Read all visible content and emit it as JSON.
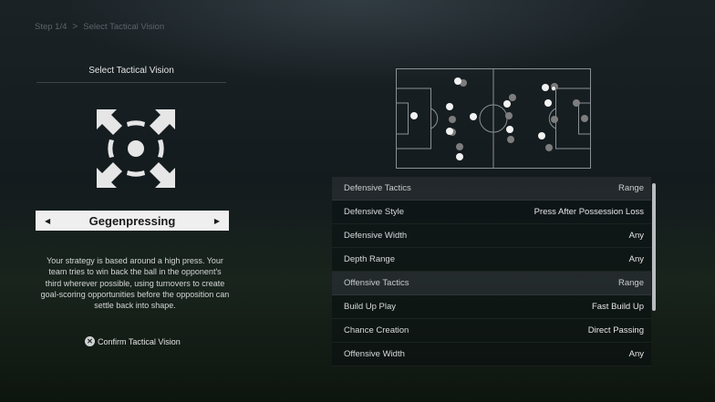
{
  "breadcrumb": {
    "step": "Step 1/4",
    "separator": ">",
    "current": "Select Tactical Vision"
  },
  "left": {
    "title": "Select Tactical Vision",
    "vision_name": "Gegenpressing",
    "prev_arrow": "◀",
    "next_arrow": "▶",
    "description": "Your strategy is based around a high press. Your team tries to win back the ball in the opponent's third wherever possible, using turnovers to create goal-scoring opportunities before the opposition can settle back into shape.",
    "confirm_button_glyph": "✕",
    "confirm_label": "Confirm Tactical Vision",
    "icon": "press-arrows-icon"
  },
  "tactics": [
    {
      "label": "Defensive Tactics",
      "value": "Range",
      "header": true
    },
    {
      "label": "Defensive Style",
      "value": "Press After Possession Loss",
      "header": false
    },
    {
      "label": "Defensive Width",
      "value": "Any",
      "header": false
    },
    {
      "label": "Depth Range",
      "value": "Any",
      "header": false
    },
    {
      "label": "Offensive Tactics",
      "value": "Range",
      "header": true
    },
    {
      "label": "Build Up Play",
      "value": "Fast Build Up",
      "header": false
    },
    {
      "label": "Chance Creation",
      "value": "Direct Passing",
      "header": false
    },
    {
      "label": "Offensive Width",
      "value": "Any",
      "header": false
    }
  ],
  "colors": {
    "selector_bg": "#efefef",
    "team_white": "#f2f2f2",
    "team_grey": "#7d7d7d",
    "pitch_lines": "#8a9094"
  }
}
